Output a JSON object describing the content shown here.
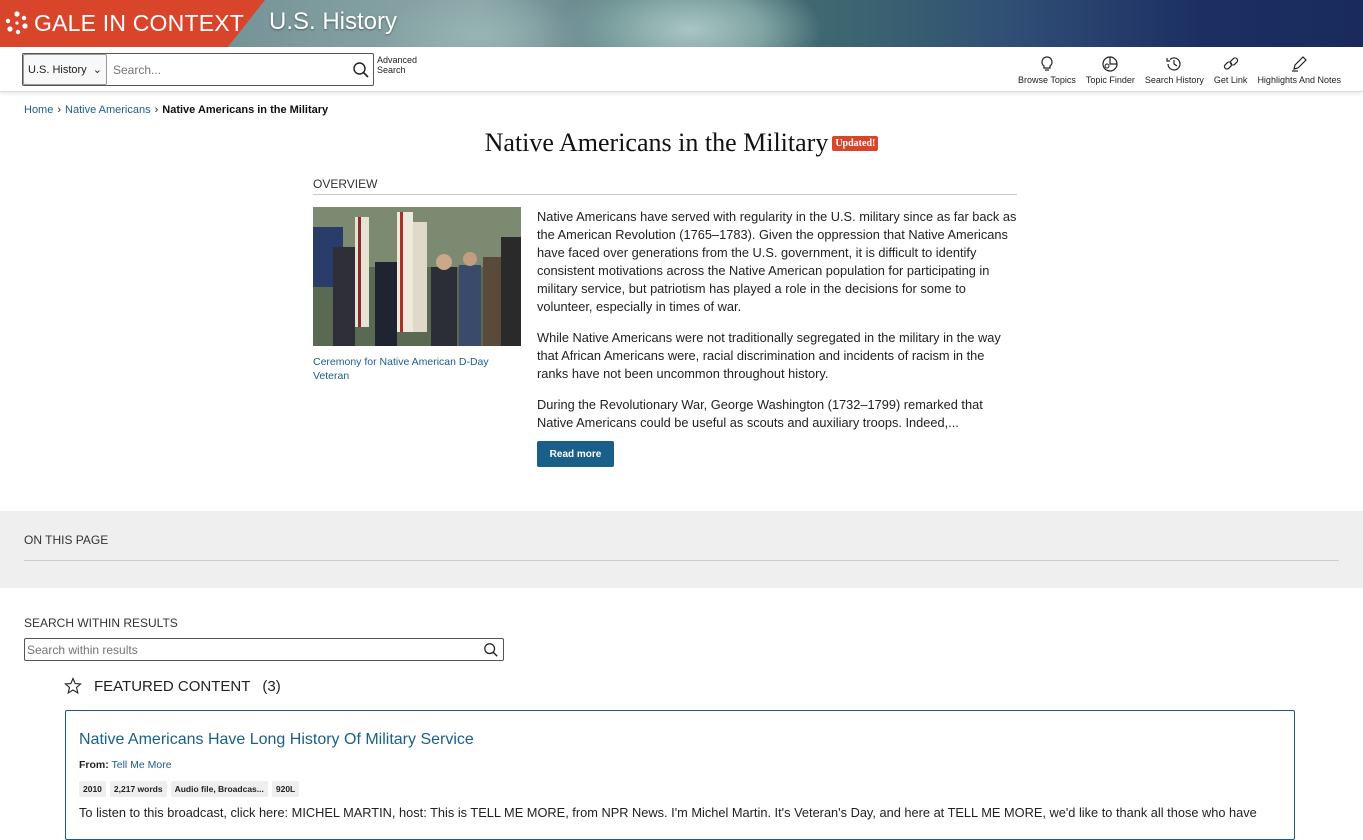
{
  "banner": {
    "brand": "GALE IN CONTEXT",
    "product": "U.S. History"
  },
  "toolbar": {
    "scope_value": "U.S. History",
    "search_placeholder": "Search...",
    "advanced_line1": "Advanced",
    "advanced_line2": "Search",
    "tools": [
      {
        "label": "Browse Topics",
        "icon": "lightbulb-icon"
      },
      {
        "label": "Topic Finder",
        "icon": "topic-finder-icon"
      },
      {
        "label": "Search History",
        "icon": "history-icon"
      },
      {
        "label": "Get Link",
        "icon": "link-icon"
      },
      {
        "label": "Highlights And Notes",
        "icon": "pen-icon"
      }
    ]
  },
  "breadcrumb": {
    "home": "Home",
    "parent": "Native Americans",
    "current": "Native Americans in the Military"
  },
  "page": {
    "title": "Native Americans in the Military",
    "badge": "Updated!",
    "overview_label": "OVERVIEW",
    "image_caption": "Ceremony for Native American D-Day Veteran",
    "paragraphs": [
      "Native Americans have served with regularity in the U.S. military since as far back as the American Revolution (1765–1783). Given the oppression that Native Americans have faced over generations from the U.S. government, it is difficult to identify consistent motivations across the Native American population for participating in military service, but patriotism has played a role in the decisions for some to volunteer, especially in times of war.",
      "While Native Americans were not traditionally segregated in the military in the way that African Americans were, racial discrimination and incidents of racism in the ranks have not been uncommon throughout history.",
      "During the Revolutionary War, George Washington (1732–1799) remarked that Native Americans could be useful as scouts and auxiliary troops. Indeed,..."
    ],
    "read_more": "Read more"
  },
  "on_this_page": {
    "label": "ON THIS PAGE"
  },
  "search_within": {
    "label": "SEARCH WITHIN RESULTS",
    "placeholder": "Search within results"
  },
  "featured": {
    "label": "FEATURED CONTENT",
    "count": "(3)",
    "card": {
      "title": "Native Americans Have Long History Of Military Service",
      "from_label": "From:",
      "from_value": "Tell Me More",
      "tags": [
        "2010",
        "2,217 words",
        "Audio file, Broadcas...",
        "920L"
      ],
      "body": "To listen to this broadcast, click here: MICHEL MARTIN, host: This is TELL ME MORE, from NPR News. I'm Michel Martin. It's Veteran's Day, and here at TELL ME MORE, we'd like to thank all those who have"
    }
  },
  "colors": {
    "brand": "#d8452b",
    "link": "#1a5f8a"
  }
}
